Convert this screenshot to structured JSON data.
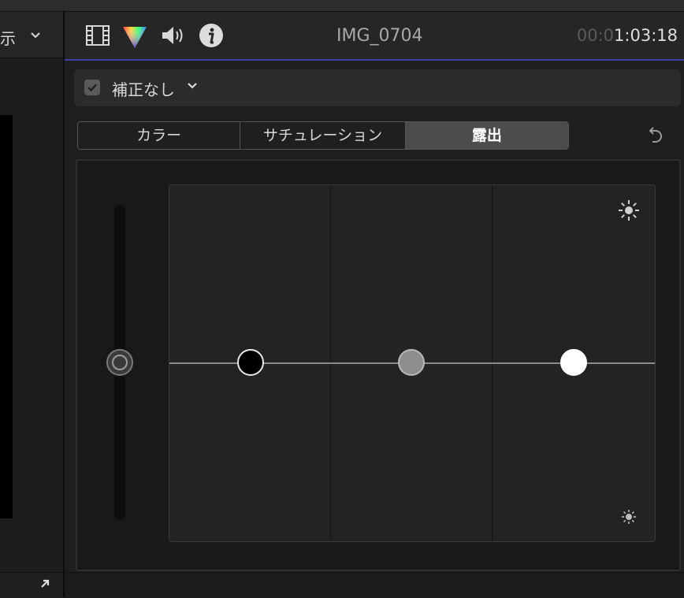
{
  "left_panel": {
    "header_text": "示",
    "expand_icon": "arrow-up-right-icon"
  },
  "inspector": {
    "icons": [
      "film-icon",
      "color-prism-icon",
      "speaker-icon",
      "info-icon"
    ],
    "clip_title": "IMG_0704",
    "timecode_dim": "00:0",
    "timecode_bright": "1:03:18",
    "underline_color": "#3e3fa0"
  },
  "correction": {
    "checked": true,
    "label": "補正なし"
  },
  "tabs": [
    {
      "label": "カラー",
      "active": false
    },
    {
      "label": "サチュレーション",
      "active": false
    },
    {
      "label": "露出",
      "active": true
    }
  ],
  "exposure": {
    "master_level": 0.5,
    "shadows_level": 0.5,
    "midtones_level": 0.5,
    "highlights_level": 0.5
  }
}
